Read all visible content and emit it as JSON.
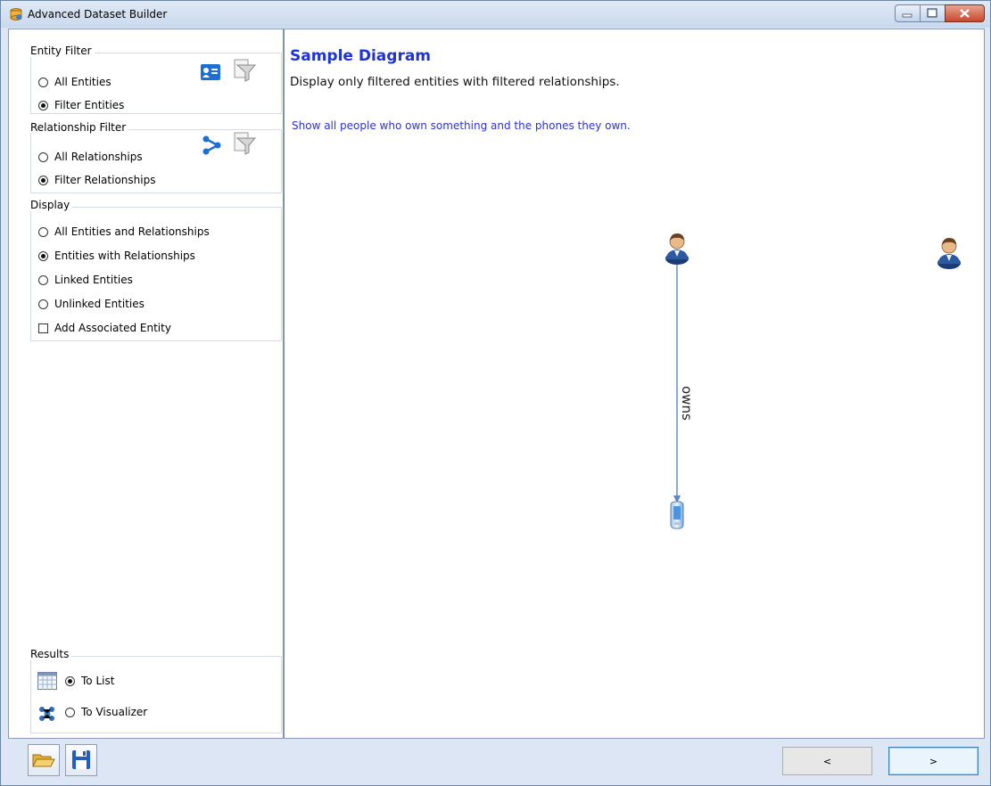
{
  "window": {
    "title": "Advanced Dataset Builder"
  },
  "entity_filter": {
    "legend": "Entity Filter",
    "options": [
      "All Entities",
      "Filter Entities"
    ]
  },
  "relationship_filter": {
    "legend": "Relationship Filter",
    "options": [
      "All Relationships",
      "Filter Relationships"
    ]
  },
  "display": {
    "legend": "Display",
    "options": [
      "All Entities and Relationships",
      "Entities with Relationships",
      "Linked Entities",
      "Unlinked Entities"
    ],
    "checkbox": "Add Associated Entity"
  },
  "results": {
    "legend": "Results",
    "options": [
      "To List",
      "To Visualizer"
    ]
  },
  "diagram": {
    "title": "Sample Diagram",
    "subtitle": "Display only filtered entities with filtered relationships.",
    "description": "Show all people who own something and the phones they own.",
    "edge_label": "owns"
  },
  "nav": {
    "prev_label": "<",
    "next_label": ">"
  },
  "colors": {
    "title_blue": "#1e33d8",
    "edge": "#5f86c9",
    "window_bg": "#dce6f4"
  }
}
